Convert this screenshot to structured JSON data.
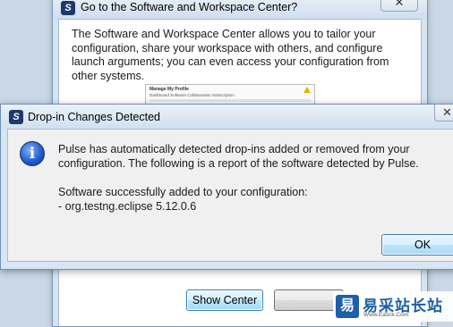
{
  "back_dialog": {
    "title": "Go to the Software and Workspace Center?",
    "close_glyph": "✕",
    "description": "The Software and Workspace Center allows you to tailor your configuration, share your workspace with others, and configure launch arguments; you can even access your configuration from other systems.",
    "thumbnail": {
      "title": "Manage My Profile",
      "tabs": "Dashboard   Software   Collaboration   Subscription"
    },
    "show_center_label": "Show Center"
  },
  "front_dialog": {
    "title": "Drop-in Changes Detected",
    "close_glyph": "✕",
    "icon": "info-icon",
    "icon_glyph": "i",
    "message_line1": "Pulse has automatically detected drop-ins added or removed from your configuration.  The following is a report of the software detected by Pulse.",
    "message_line2": "Software successfully added to your configuration:",
    "message_line3": "- org.testng.eclipse 5.12.0.6",
    "ok_label": "OK"
  },
  "app_icon_glyph": "S",
  "watermark": {
    "logo_glyph": "易",
    "text": "易采站长站",
    "url": "Www.Easck.Com"
  },
  "colors": {
    "accent_button_border": "#3c7fb1",
    "titlebar": "#d7e5f4",
    "info_icon": "#1f58c7"
  }
}
